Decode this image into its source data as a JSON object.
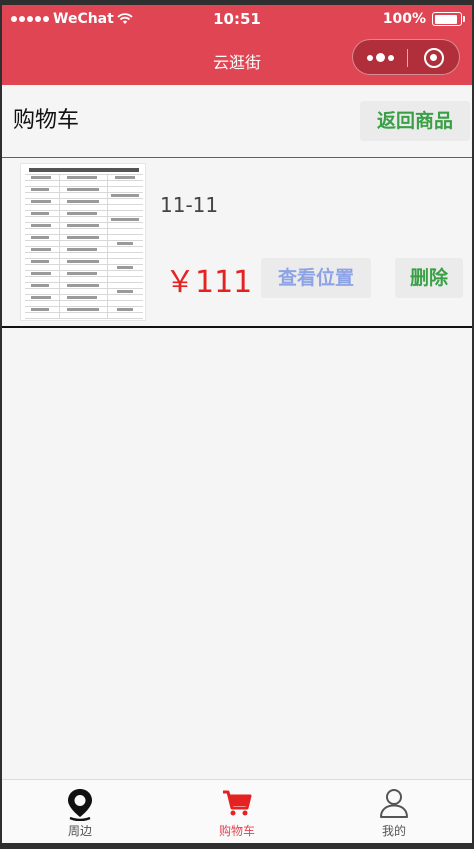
{
  "status_bar": {
    "signal_dots": 5,
    "carrier": "WeChat",
    "time": "10:51",
    "battery": "100%"
  },
  "nav": {
    "title": "云逛街",
    "accent_color": "#e04553"
  },
  "header": {
    "title": "购物车",
    "back_label": "返回商品"
  },
  "cart": {
    "items": [
      {
        "name": "11-11",
        "price": "￥111",
        "view_location_label": "查看位置",
        "delete_label": "删除"
      }
    ]
  },
  "tabbar": {
    "tabs": [
      {
        "label": "周边",
        "icon": "location-pin-icon",
        "active": false
      },
      {
        "label": "购物车",
        "icon": "cart-icon",
        "active": true
      },
      {
        "label": "我的",
        "icon": "user-icon",
        "active": false
      }
    ],
    "active_color": "#e04553",
    "inactive_color": "#555555"
  }
}
